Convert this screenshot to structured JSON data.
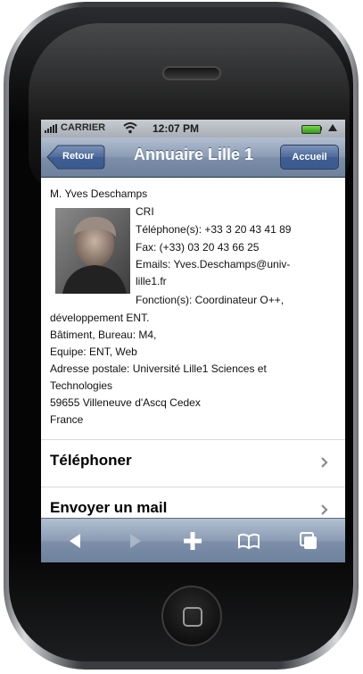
{
  "status_bar": {
    "carrier": "CARRIER",
    "time": "12:07 PM"
  },
  "nav": {
    "back_label": "Retour",
    "title": "Annuaire Lille 1",
    "home_label": "Accueil"
  },
  "contact": {
    "name": "M. Yves Deschamps",
    "service": "CRI",
    "phone": "Téléphone(s): +33 3 20 43 41 89",
    "fax": "Fax: (+33) 03 20 43 66 25",
    "emails_line1": "Emails: Yves.Deschamps@univ-",
    "emails_line2": "lille1.fr",
    "function_line1": "Fonction(s): Coordinateur O++,",
    "function_line2": "développement ENT.",
    "building": "Bâtiment, Bureau: M4,",
    "team": "Equipe: ENT, Web",
    "address_line1": "Adresse postale: Université Lille1 Sciences et",
    "address_line2": "Technologies",
    "address_line3": "59655 Villeneuve d'Ascq Cedex",
    "country": "France"
  },
  "actions": {
    "call_label": "Téléphoner",
    "mail_label": "Envoyer un mail"
  },
  "toolbar": {
    "icons": [
      "back-arrow-icon",
      "forward-arrow-icon",
      "plus-icon",
      "bookmarks-icon",
      "pages-icon"
    ]
  },
  "colors": {
    "nav_bar": "#7d8fa9",
    "button_blue": "#3f5e93"
  }
}
